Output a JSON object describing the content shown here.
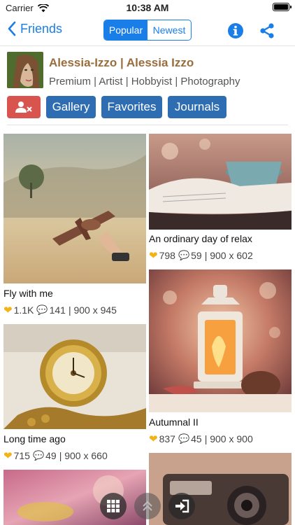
{
  "status": {
    "carrier": "Carrier",
    "time": "10:38 AM"
  },
  "nav": {
    "back_label": "Friends",
    "tabs": [
      "Popular",
      "Newest"
    ],
    "active_tab": "Popular"
  },
  "profile": {
    "name": "Alessia-Izzo | Alessia Izzo",
    "subtitle": "Premium | Artist | Hobbyist | Photography"
  },
  "actions": {
    "gallery": "Gallery",
    "favorites": "Favorites",
    "journals": "Journals"
  },
  "deviations": [
    {
      "title": "Fly with me",
      "favs": "1.1K",
      "comments": "141",
      "size": "| 900 x 945"
    },
    {
      "title": "An ordinary day of relax",
      "favs": "798",
      "comments": "59",
      "size": "| 900 x 602"
    },
    {
      "title": "Long time ago",
      "favs": "715",
      "comments": "49",
      "size": "| 900 x 660"
    },
    {
      "title": "Autumnal II",
      "favs": "837",
      "comments": "45",
      "size": "| 900 x 900"
    }
  ],
  "colors": {
    "accent": "#1a7ee8",
    "button": "#2e6db1",
    "remove_button": "#d9534f",
    "name": "#9a6d3d"
  }
}
